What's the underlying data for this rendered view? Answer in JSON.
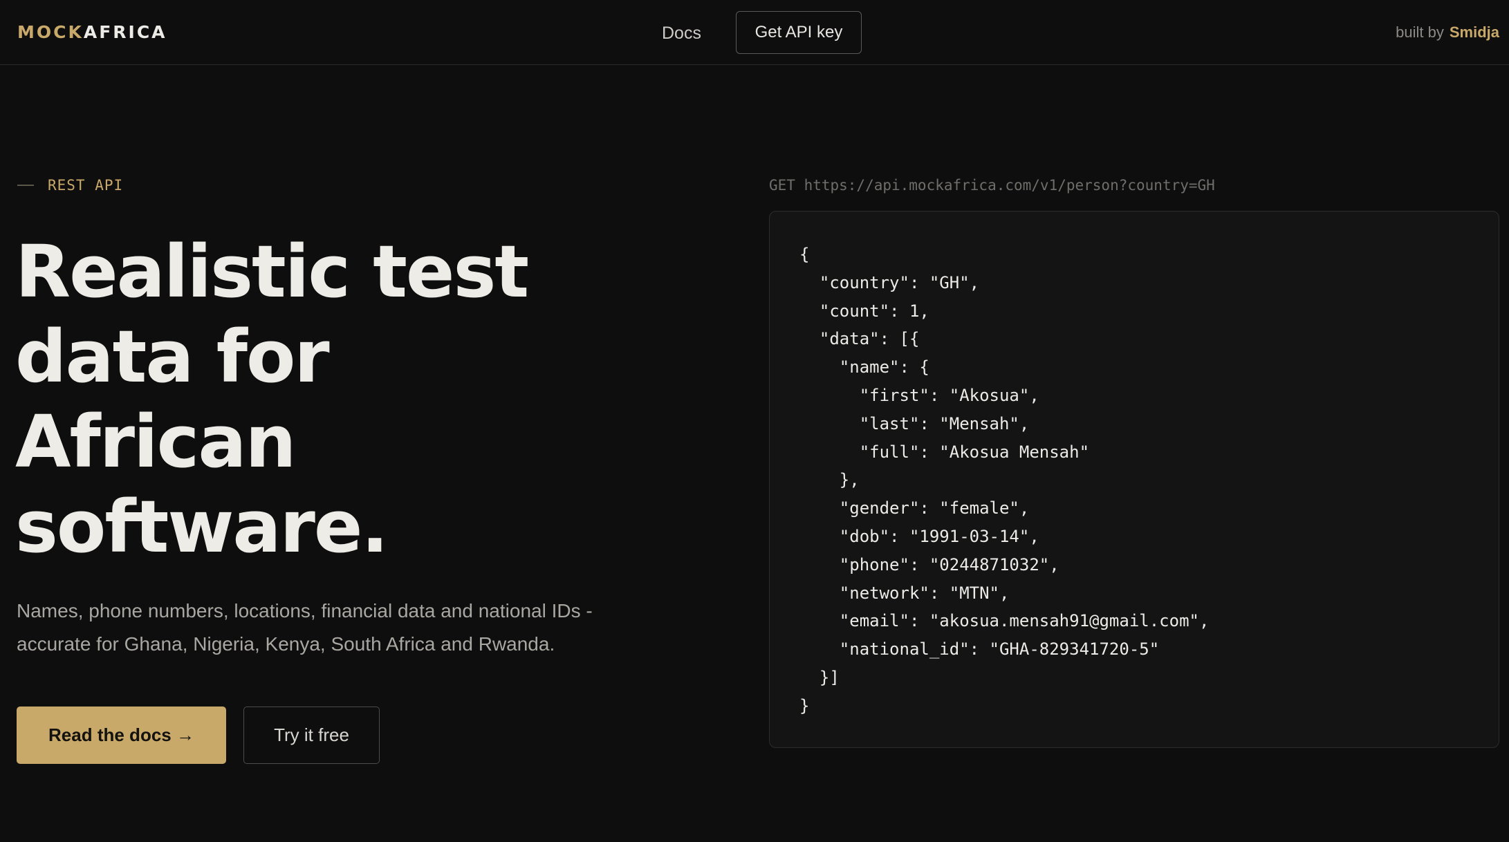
{
  "header": {
    "logo_part1": "MOCK",
    "logo_part2": "AFRICA",
    "nav_docs": "Docs",
    "nav_api_key": "Get API key",
    "built_by_label": "built by",
    "built_by_name": "Smidja"
  },
  "hero": {
    "eyebrow": "REST API",
    "headline_lines": [
      "Realistic test",
      "data for",
      "African",
      "software."
    ],
    "subtext_line1": "Names, phone numbers, locations, financial data and national IDs -",
    "subtext_line2": "accurate for Ghana, Nigeria, Kenya, South Africa and Rwanda.",
    "primary_button": "Read the docs →",
    "secondary_button": "Try it free"
  },
  "code_sample": {
    "endpoint": "GET https://api.mockafrica.com/v1/person?country=GH",
    "body": "{\n  \"country\": \"GH\",\n  \"count\": 1,\n  \"data\": [{\n    \"name\": {\n      \"first\": \"Akosua\",\n      \"last\": \"Mensah\",\n      \"full\": \"Akosua Mensah\"\n    },\n    \"gender\": \"female\",\n    \"dob\": \"1991-03-14\",\n    \"phone\": \"0244871032\",\n    \"network\": \"MTN\",\n    \"email\": \"akosua.mensah91@gmail.com\",\n    \"national_id\": \"GHA-829341720-5\"\n  }]\n}"
  },
  "colors": {
    "background": "#0e0e0f",
    "accent_gold": "#c9a96a",
    "text_primary": "#eeece7",
    "text_muted": "#a9a7a2",
    "panel_bg": "#141415"
  }
}
